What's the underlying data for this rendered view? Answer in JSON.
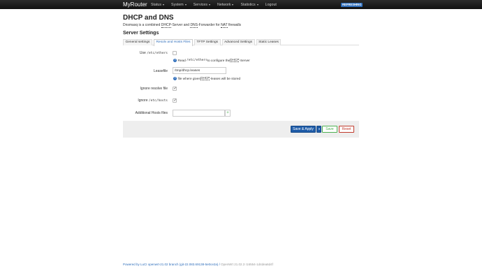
{
  "navbar": {
    "brand": "MyRouter",
    "menu": [
      {
        "label": "Status"
      },
      {
        "label": "System"
      },
      {
        "label": "Services"
      },
      {
        "label": "Network"
      },
      {
        "label": "Statistics"
      },
      {
        "label": "Logout"
      }
    ],
    "status_badge": "REFRESHING"
  },
  "page": {
    "title": "DHCP and DNS",
    "description_prefix": "Dnsmasq is a combined ",
    "description_dhcp": "DHCP",
    "description_mid": "-Server and ",
    "description_dns": "DNS",
    "description_mid2": "-Forwarder for ",
    "description_nat": "NAT",
    "description_suffix": " firewalls"
  },
  "section": {
    "title": "Server Settings",
    "tabs": [
      {
        "label": "General settings",
        "active": false
      },
      {
        "label": "Resolv and Hosts Files",
        "active": true
      },
      {
        "label": "TFTP Settings",
        "active": false
      },
      {
        "label": "Advanced Settings",
        "active": false
      },
      {
        "label": "Static Leases",
        "active": false
      }
    ]
  },
  "form": {
    "use_ethers": {
      "label_prefix": "Use ",
      "label_code": "/etc/ethers",
      "checked": false,
      "help_prefix": "Read ",
      "help_code": "/etc/ethers",
      "help_mid": " to configure the ",
      "help_dhcp": "DHCP",
      "help_suffix": "-Server"
    },
    "leasefile": {
      "label": "Leasefile",
      "value": "/tmp/dhcp.leases",
      "help_prefix": "file where given ",
      "help_dhcp": "DHCP",
      "help_suffix": "-leases will be stored"
    },
    "ignore_resolve": {
      "label": "Ignore resolve file",
      "checked": true
    },
    "ignore_hosts": {
      "label_prefix": "Ignore ",
      "label_code": "/etc/hosts",
      "checked": true
    },
    "additional_hosts": {
      "label": "Additional Hosts files",
      "value": "",
      "add_symbol": "+"
    }
  },
  "actions": {
    "save_apply": "Save & Apply",
    "save": "Save",
    "reset": "Reset"
  },
  "footer": {
    "link": "Powered by LuCI openwrt-21.02 branch (git-22.083.69138-5e0ce2a)",
    "version": "OpenWrt 21.02.3 r16554-1d4dea6d4f"
  },
  "colors": {
    "navbar": "#1e1e1e",
    "accent": "#2f6ebb",
    "save": "#4caf50",
    "reset": "#c0392b"
  }
}
